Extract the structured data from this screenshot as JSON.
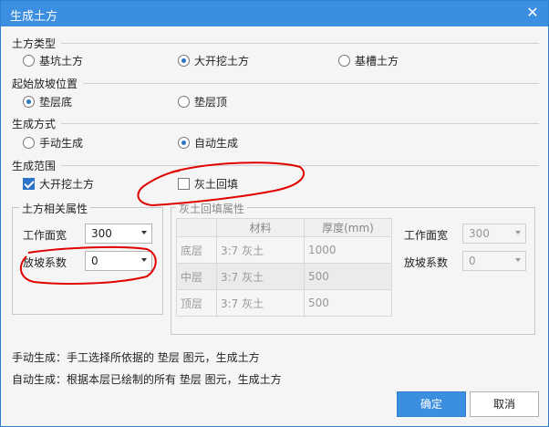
{
  "window": {
    "title": "生成土方",
    "close_glyph": "✕"
  },
  "earth_type": {
    "label": "土方类型",
    "options": [
      "基坑土方",
      "大开挖土方",
      "基槽土方"
    ],
    "selected": 1
  },
  "slope_start": {
    "label": "起始放坡位置",
    "options": [
      "垫层底",
      "垫层顶"
    ],
    "selected": 0
  },
  "gen_mode": {
    "label": "生成方式",
    "options": [
      "手动生成",
      "自动生成"
    ],
    "selected": 1
  },
  "gen_range": {
    "label": "生成范围",
    "opt1": "大开挖土方",
    "opt1_checked": true,
    "opt2": "灰土回填",
    "opt2_checked": false
  },
  "earth_props": {
    "label": "土方相关属性",
    "work_width_label": "工作面宽",
    "work_width_value": "300",
    "slope_label": "放坡系数",
    "slope_value": "0"
  },
  "backfill_props": {
    "label": "灰土回填属性",
    "col_material": "材料",
    "col_thickness": "厚度(mm)",
    "rows": [
      {
        "layer": "底层",
        "material": "3:7 灰土",
        "thickness": "1000"
      },
      {
        "layer": "中层",
        "material": "3:7 灰土",
        "thickness": "500"
      },
      {
        "layer": "顶层",
        "material": "3:7 灰土",
        "thickness": "500"
      }
    ],
    "work_width_label": "工作面宽",
    "work_width_value": "300",
    "slope_label": "放坡系数",
    "slope_value": "0"
  },
  "notes": {
    "manual": "手动生成：手工选择所依据的 垫层 图元，生成土方",
    "auto": "自动生成：根据本层已绘制的所有 垫层 图元，生成土方"
  },
  "buttons": {
    "ok": "确定",
    "cancel": "取消"
  },
  "colors": {
    "accent": "#3c8ee0",
    "annotation": "#e00000"
  }
}
